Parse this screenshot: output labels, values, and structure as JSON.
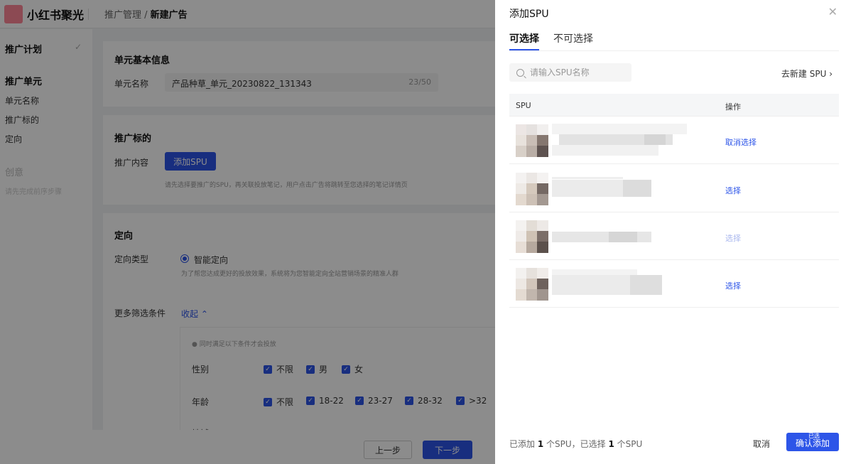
{
  "app": {
    "logo_text": "小红书聚光",
    "breadcrumb_parent": "推广管理 / ",
    "breadcrumb_current": "新建广告"
  },
  "sidebar": {
    "plan": "推广计划",
    "unit": "推广单元",
    "unit_items": [
      "单元名称",
      "推广标的",
      "定向"
    ],
    "creative": "创意",
    "creative_hint": "请先完成前序步骤"
  },
  "form": {
    "basic_title": "单元基本信息",
    "unit_name_label": "单元名称",
    "unit_name_value": "产品种草_单元_20230822_131343",
    "unit_name_count": "23/50",
    "target_title": "推广标的",
    "content_label": "推广内容",
    "add_spu_button": "添加SPU",
    "content_hint": "请先选择要推广的SPU，再关联投放笔记，用户点击广告将跳转至您选择的笔记详情页",
    "targeting_title": "定向",
    "targeting_type_label": "定向类型",
    "targeting_type_value": "智能定向",
    "targeting_hint": "为了帮您达成更好的投放效果，系统将为您智能定向全站营销场景的精准人群",
    "more_filters_label": "更多筛选条件",
    "collapse_link": "收起",
    "filter_note": "同时满足以下条件才会投放",
    "gender_label": "性别",
    "gender_options": [
      "不限",
      "男",
      "女"
    ],
    "age_label": "年龄",
    "age_options": [
      "不限",
      "18-22",
      "23-27",
      "28-32",
      ">32"
    ],
    "region_label": "地域",
    "prev_button": "上一步",
    "next_button": "下一步"
  },
  "drawer": {
    "title": "添加SPU",
    "tabs": [
      "可选择",
      "不可选择"
    ],
    "search_placeholder": "请输入SPU名称",
    "new_spu_link": "去新建 SPU",
    "columns": [
      "SPU",
      "操作"
    ],
    "rows": [
      {
        "action": "取消选择",
        "disabled": false
      },
      {
        "action": "选择",
        "disabled": false
      },
      {
        "action": "选择",
        "disabled": true
      },
      {
        "action": "选择",
        "disabled": false
      }
    ],
    "summary_prefix": "已添加 ",
    "added_count": "1",
    "summary_middle": " 个SPU，已选择 ",
    "selected_count": "1",
    "summary_suffix": " 个SPU",
    "cancel_button": "取消",
    "confirm_badge": "已选",
    "confirm_button": "确认添加"
  },
  "colors": {
    "accent": "#2d55e8",
    "brand": "#ff2442"
  }
}
